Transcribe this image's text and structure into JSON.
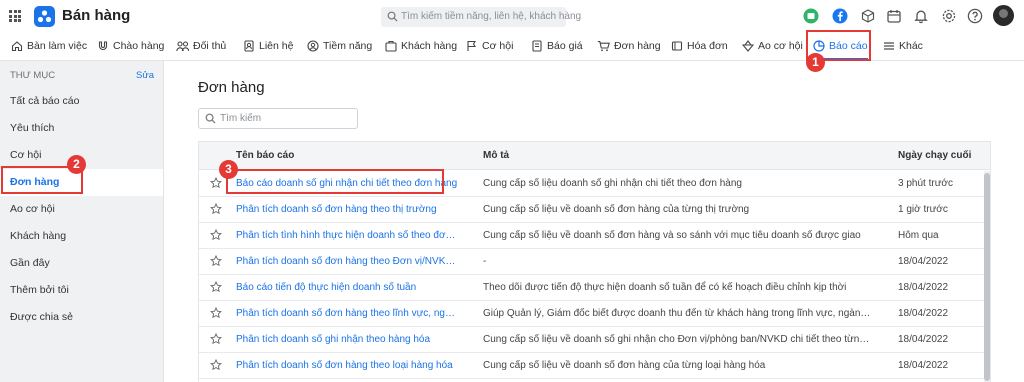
{
  "app": {
    "title": "Bán hàng",
    "search_placeholder": "Tìm kiếm tiềm năng, liên hệ, khách hàng",
    "brand_color": "#1a73e8"
  },
  "nav": {
    "items": [
      {
        "label": "Bàn làm việc",
        "icon": "home-icon"
      },
      {
        "label": "Chào hàng",
        "icon": "magnet-icon"
      },
      {
        "label": "Đối thủ",
        "icon": "competitor-icon"
      },
      {
        "label": "Liên hệ",
        "icon": "contact-icon"
      },
      {
        "label": "Tiềm năng",
        "icon": "lead-icon"
      },
      {
        "label": "Khách hàng",
        "icon": "customer-icon"
      },
      {
        "label": "Cơ hội",
        "icon": "opportunity-icon"
      },
      {
        "label": "Báo giá",
        "icon": "quote-icon"
      },
      {
        "label": "Đơn hàng",
        "icon": "cart-icon"
      },
      {
        "label": "Hóa đơn",
        "icon": "invoice-icon"
      },
      {
        "label": "Ao cơ hội",
        "icon": "pool-icon"
      },
      {
        "label": "Báo cáo",
        "icon": "report-icon",
        "active": true
      },
      {
        "label": "Khác",
        "icon": "menu-icon"
      }
    ]
  },
  "sidebar": {
    "header": "THƯ MỤC",
    "edit_label": "Sửa",
    "items": [
      {
        "label": "Tất cả báo cáo"
      },
      {
        "label": "Yêu thích"
      },
      {
        "label": "Cơ hội"
      },
      {
        "label": "Đơn hàng",
        "active": true
      },
      {
        "label": "Ao cơ hội"
      },
      {
        "label": "Khách hàng"
      },
      {
        "label": "Gần đây"
      },
      {
        "label": "Thêm bởi tôi"
      },
      {
        "label": "Được chia sẻ"
      }
    ]
  },
  "main": {
    "title": "Đơn hàng",
    "search_placeholder": "Tìm kiếm",
    "columns": {
      "name": "Tên báo cáo",
      "description": "Mô tả",
      "last_run": "Ngày chạy cuối"
    },
    "rows": [
      {
        "name": "Báo cáo doanh số ghi nhận chi tiết theo đơn hàng",
        "description": "Cung cấp số liệu doanh số ghi nhận chi tiết theo đơn hàng",
        "last_run": "3 phút trước"
      },
      {
        "name": "Phân tích doanh số đơn hàng theo thị trường",
        "description": "Cung cấp số liệu về doanh số đơn hàng của từng thị trường",
        "last_run": "1 giờ trước"
      },
      {
        "name": "Phân tích tình hình thực hiện doanh số theo đơn hàng",
        "description": "Cung cấp số liệu về doanh số đơn hàng và so sánh với mục tiêu doanh số được giao",
        "last_run": "Hôm qua"
      },
      {
        "name": "Phân tích doanh số đơn hàng theo Đơn vị/NVKD và loại ...",
        "description": "-",
        "last_run": "18/04/2022"
      },
      {
        "name": "Báo cáo tiến độ thực hiện doanh số tuần",
        "description": "Theo dõi được tiến độ thực hiện doanh số tuần để có kế hoạch điều chỉnh kịp thời",
        "last_run": "18/04/2022"
      },
      {
        "name": "Phân tích doanh số đơn hàng theo lĩnh vực, ngành nghề ...",
        "description": "Giúp Quản lý, Giám đốc biết được doanh thu đến từ khách hàng trong lĩnh vực, ngành nghề nào để có...",
        "last_run": "18/04/2022"
      },
      {
        "name": "Phân tích doanh số ghi nhận theo hàng hóa",
        "description": "Cung cấp số liệu về doanh số ghi nhận cho Đơn vị/phòng ban/NVKD chi tiết theo từng loại hàng hóa",
        "last_run": "18/04/2022"
      },
      {
        "name": "Phân tích doanh số đơn hàng theo loại hàng hóa",
        "description": "Cung cấp số liệu về doanh số đơn hàng của từng loại hàng hóa",
        "last_run": "18/04/2022"
      }
    ]
  },
  "annotations": {
    "step1": "1",
    "step2": "2",
    "step3": "3",
    "color": "#e53935"
  }
}
